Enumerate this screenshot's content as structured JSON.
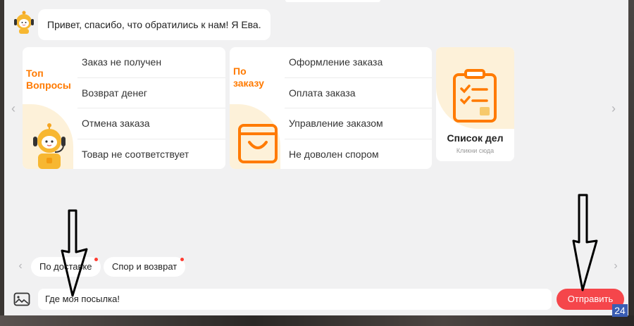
{
  "chat": {
    "greeting": "Привет, спасибо, что обратились к нам! Я Ева."
  },
  "cards": {
    "top_questions": {
      "title_line1": "Топ",
      "title_line2": "Вопросы",
      "items": [
        "Заказ не получен",
        "Возврат денег",
        "Отмена заказа",
        "Товар не соответствует"
      ]
    },
    "by_order": {
      "title_line1": "По",
      "title_line2": "заказу",
      "items": [
        "Оформление заказа",
        "Оплата заказа",
        "Управление заказом",
        "Не доволен спором"
      ]
    },
    "todo": {
      "title": "Список дел",
      "subtitle": "Кликни сюда"
    }
  },
  "chips": [
    "По доставке",
    "Спор и возврат"
  ],
  "composer": {
    "input_value": "Где моя посылка!",
    "send_label": "Отправить"
  },
  "watermark": "24",
  "colors": {
    "accent_orange": "#ff7a00",
    "send_red": "#f5464b",
    "panel_bg": "#f1f1f2"
  }
}
